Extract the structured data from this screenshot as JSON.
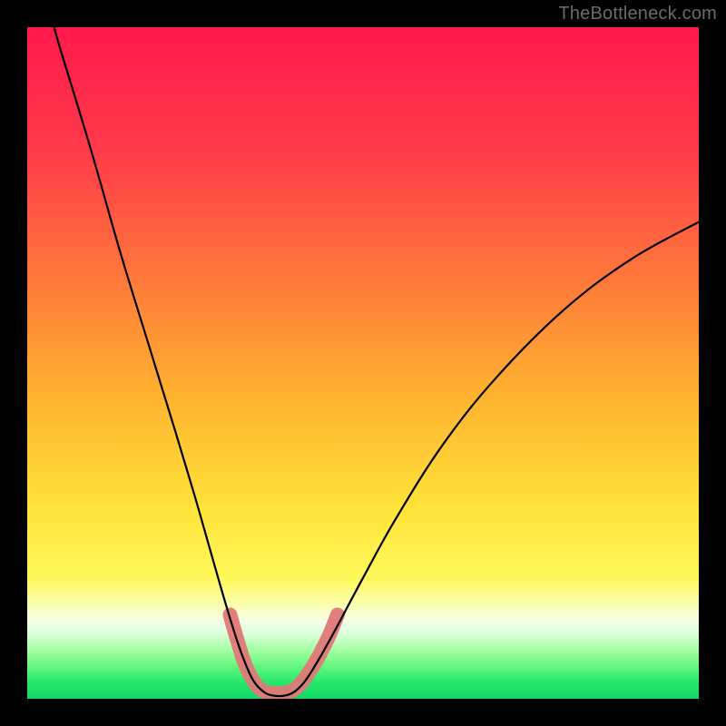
{
  "watermark": "TheBottleneck.com",
  "chart_data": {
    "type": "line",
    "title": "",
    "xlabel": "",
    "ylabel": "",
    "xlim": [
      0,
      100
    ],
    "ylim": [
      0,
      100
    ],
    "background_gradient": {
      "stops": [
        {
          "pos": 0.0,
          "color": "#ff1a4c"
        },
        {
          "pos": 0.18,
          "color": "#ff3a4a"
        },
        {
          "pos": 0.38,
          "color": "#ff7a3a"
        },
        {
          "pos": 0.55,
          "color": "#ffb330"
        },
        {
          "pos": 0.72,
          "color": "#ffe43a"
        },
        {
          "pos": 0.82,
          "color": "#fff85a"
        },
        {
          "pos": 0.86,
          "color": "#faffb0"
        },
        {
          "pos": 0.885,
          "color": "#f6ffe8"
        },
        {
          "pos": 0.905,
          "color": "#d8ffd8"
        },
        {
          "pos": 0.93,
          "color": "#9dff9d"
        },
        {
          "pos": 0.955,
          "color": "#5cf57c"
        },
        {
          "pos": 0.975,
          "color": "#28e86c"
        },
        {
          "pos": 1.0,
          "color": "#10d865"
        }
      ]
    },
    "series": [
      {
        "name": "bottleneck-curve",
        "color": "#000000",
        "width": 2.2,
        "points": [
          {
            "x": 4,
            "y": 100
          },
          {
            "x": 5,
            "y": 96.5
          },
          {
            "x": 7,
            "y": 90
          },
          {
            "x": 10,
            "y": 80
          },
          {
            "x": 14,
            "y": 66
          },
          {
            "x": 18,
            "y": 53
          },
          {
            "x": 22,
            "y": 40
          },
          {
            "x": 25,
            "y": 30
          },
          {
            "x": 27,
            "y": 23
          },
          {
            "x": 29,
            "y": 16
          },
          {
            "x": 30.5,
            "y": 11
          },
          {
            "x": 32,
            "y": 6.5
          },
          {
            "x": 33.5,
            "y": 3
          },
          {
            "x": 35,
            "y": 1.2
          },
          {
            "x": 36.5,
            "y": 0.5
          },
          {
            "x": 38.5,
            "y": 0.5
          },
          {
            "x": 40,
            "y": 1.2
          },
          {
            "x": 41.5,
            "y": 2.8
          },
          {
            "x": 43.5,
            "y": 6
          },
          {
            "x": 46,
            "y": 10.5
          },
          {
            "x": 50,
            "y": 18
          },
          {
            "x": 55,
            "y": 27
          },
          {
            "x": 62,
            "y": 38
          },
          {
            "x": 70,
            "y": 48
          },
          {
            "x": 80,
            "y": 58
          },
          {
            "x": 90,
            "y": 65.5
          },
          {
            "x": 100,
            "y": 71
          }
        ]
      },
      {
        "name": "highlight-band",
        "color": "#e07878",
        "width": 16,
        "linecap": "round",
        "points": [
          {
            "x": 30.2,
            "y": 12.5
          },
          {
            "x": 31.2,
            "y": 9
          },
          {
            "x": 32.5,
            "y": 5
          },
          {
            "x": 34,
            "y": 2.2
          },
          {
            "x": 35.5,
            "y": 1
          },
          {
            "x": 37.5,
            "y": 0.8
          },
          {
            "x": 39,
            "y": 1
          },
          {
            "x": 40.5,
            "y": 2
          },
          {
            "x": 42,
            "y": 4
          },
          {
            "x": 43.5,
            "y": 6.5
          },
          {
            "x": 45,
            "y": 9.5
          },
          {
            "x": 46.2,
            "y": 12.5
          }
        ]
      }
    ]
  }
}
